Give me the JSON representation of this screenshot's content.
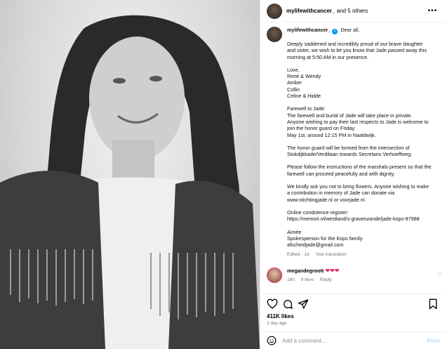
{
  "header": {
    "username": "mylifewithcancer_",
    "coauthors": "and 5 others"
  },
  "caption": {
    "username": "mylifewithcancer_",
    "lines": [
      "Dear all,",
      "",
      "Deeply saddened and incredibly proud of our brave daughter",
      "and sister, we wish to let you know that Jade passed away this",
      "morning at 5:50 AM in our presence.",
      "",
      "Love,",
      "René & Wendy",
      "Amber",
      "Collin",
      "Celine & Hidde",
      "",
      "Farewell to Jade:",
      "The farewell and burial of Jade will take place in private.",
      "Anyone wishing to pay their last respects to Jade is welcome to",
      "join the honor guard on Friday,",
      "May 1st, around 12:15 PM in Naaldwijk.",
      "",
      "The honor guard will be formed from the intersection of",
      "Stokdijkkade/Verdilaan towards Secretaris Verhoeffweg.",
      "",
      "Please follow the instructions of the marshals present so that the",
      "farewell can proceed peacefully and with dignity.",
      "",
      "We kindly ask you not to bring flowers. Anyone wishing to make",
      "a contribution in memory of Jade can donate via",
      "www.stichtingjade.nl or voorjade.nl.",
      "",
      "Online condolence register:",
      "https://memori.nl/westland/s-gravenzande/jade-kops-87988",
      "",
      "Aimée",
      "Spokesperson for the Kops family",
      "afscheidjade@gmail.com"
    ],
    "meta_edited": "Edited · 1d",
    "meta_translation": "See translation"
  },
  "comment": {
    "username": "megandegroott",
    "text": "❤❤❤",
    "time": "16h",
    "likes": "8 likes",
    "reply": "Reply"
  },
  "post": {
    "likes": "411K likes",
    "time_ago": "1 day ago"
  },
  "add_comment": {
    "placeholder": "Add a comment…",
    "post_label": "Post"
  },
  "icons": [
    "heart-icon",
    "comment-icon",
    "share-icon",
    "bookmark-icon",
    "more-icon",
    "emoji-icon",
    "verified-icon"
  ],
  "colors": {
    "accent": "#0095f6",
    "heart": "#e0245e",
    "muted": "#737373"
  }
}
